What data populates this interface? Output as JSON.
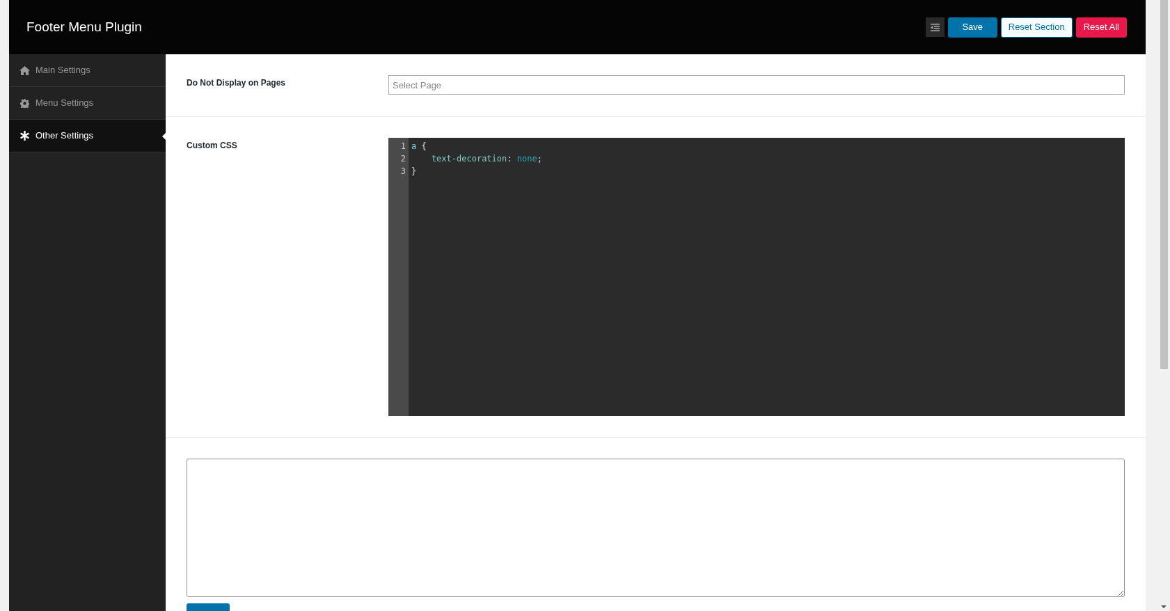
{
  "header": {
    "title": "Footer Menu Plugin",
    "buttons": [
      {
        "kind": "icon"
      },
      {
        "kind": "primary",
        "label": "Save"
      },
      {
        "kind": "outline",
        "label": "Reset Section"
      },
      {
        "kind": "danger",
        "label": "Reset All"
      }
    ]
  },
  "sidebar": {
    "items": [
      {
        "label": "Main Settings",
        "kind": "home",
        "selected": false
      },
      {
        "label": "Menu Settings",
        "kind": "gear",
        "selected": false
      },
      {
        "label": "Other Settings",
        "kind": "asterisk",
        "selected": true
      }
    ]
  },
  "fields": [
    {
      "label": "Do Not Display on Pages",
      "kind": "select",
      "placeholder": "Select Page"
    },
    {
      "label": "Custom CSS",
      "kind": "code",
      "lines": [
        {
          "number": "1",
          "tokens": [
            {
              "text": "a",
              "kind": "selector"
            },
            {
              "text": " {",
              "kind": "plain"
            }
          ]
        },
        {
          "number": "2",
          "tokens": [
            {
              "text": "    text-decoration",
              "kind": "property"
            },
            {
              "text": ": ",
              "kind": "plain"
            },
            {
              "text": "none",
              "kind": "value"
            },
            {
              "text": ";",
              "kind": "plain"
            }
          ]
        },
        {
          "number": "3",
          "tokens": [
            {
              "text": "}",
              "kind": "plain"
            }
          ]
        }
      ]
    }
  ]
}
